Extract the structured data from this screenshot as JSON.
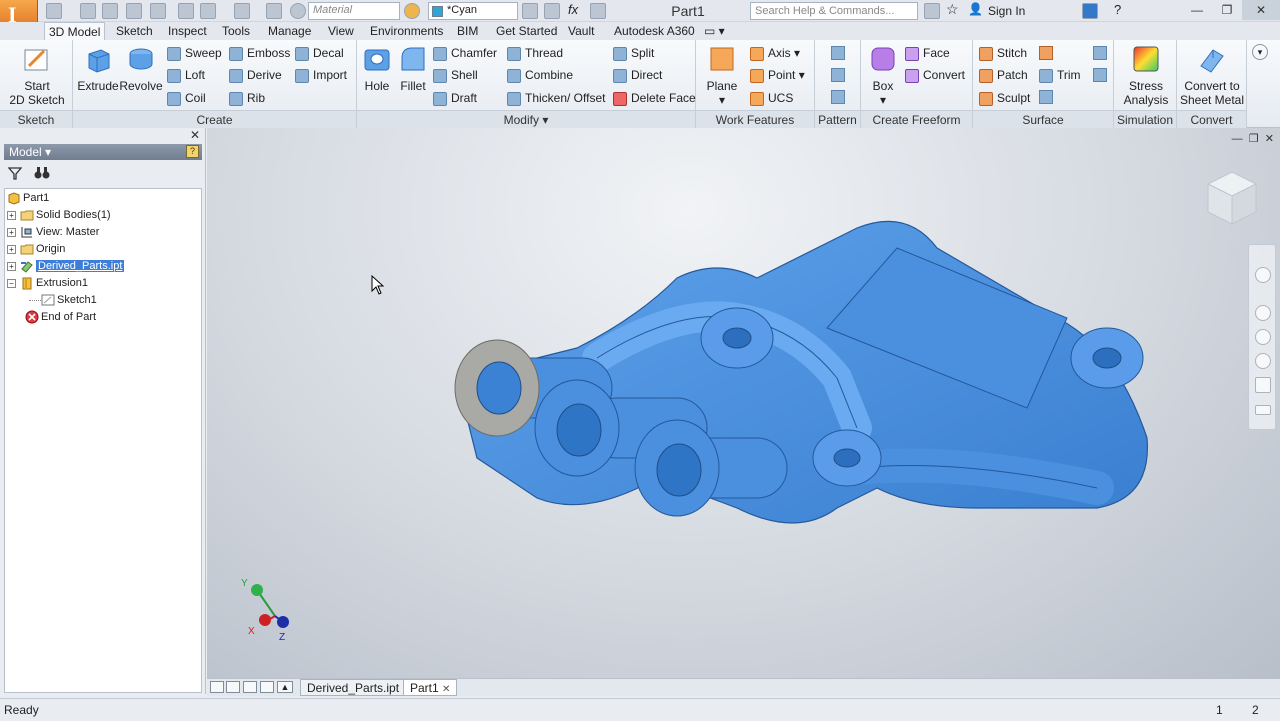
{
  "titlebar": {
    "material_placeholder": "Material",
    "appearance_value": "*Cyan",
    "document_title": "Part1",
    "help_search_placeholder": "Search Help & Commands...",
    "sign_in": "Sign In"
  },
  "menu": {
    "tabs": [
      "3D Model",
      "Sketch",
      "Inspect",
      "Tools",
      "Manage",
      "View",
      "Environments",
      "BIM",
      "Get Started",
      "Vault",
      "Autodesk A360"
    ],
    "active": "3D Model"
  },
  "ribbon": {
    "sketch": {
      "label": "Sketch",
      "start": "Start",
      "start2": "2D Sketch"
    },
    "create": {
      "label": "Create",
      "extrude": "Extrude",
      "revolve": "Revolve",
      "sweep": "Sweep",
      "loft": "Loft",
      "coil": "Coil",
      "emboss": "Emboss",
      "derive": "Derive",
      "rib": "Rib",
      "decal": "Decal",
      "import": "Import"
    },
    "modify": {
      "label": "Modify",
      "hole": "Hole",
      "fillet": "Fillet",
      "chamfer": "Chamfer",
      "shell": "Shell",
      "draft": "Draft",
      "thread": "Thread",
      "combine": "Combine",
      "thicken": "Thicken/ Offset",
      "split": "Split",
      "direct": "Direct",
      "delete_face": "Delete Face"
    },
    "work_features": {
      "label": "Work Features",
      "plane": "Plane",
      "axis": "Axis",
      "point": "Point",
      "ucs": "UCS"
    },
    "pattern": {
      "label": "Pattern"
    },
    "freeform": {
      "label": "Create Freeform",
      "box": "Box",
      "face": "Face",
      "convert": "Convert"
    },
    "surface": {
      "label": "Surface",
      "stitch": "Stitch",
      "patch": "Patch",
      "sculpt": "Sculpt",
      "trim": "Trim"
    },
    "simulation": {
      "label": "Simulation",
      "stress1": "Stress",
      "stress2": "Analysis"
    },
    "convert": {
      "label": "Convert",
      "c1": "Convert to",
      "c2": "Sheet Metal"
    }
  },
  "browser": {
    "title": "Model",
    "tree": [
      {
        "label": "Part1",
        "level": 0,
        "icon": "part-icon"
      },
      {
        "label": "Solid Bodies(1)",
        "level": 1,
        "icon": "folder-icon"
      },
      {
        "label": "View: Master",
        "level": 1,
        "icon": "view-icon"
      },
      {
        "label": "Origin",
        "level": 1,
        "icon": "folder-icon"
      },
      {
        "label": "Derived_Parts.ipt",
        "level": 1,
        "icon": "derived-icon",
        "selected": true
      },
      {
        "label": "Extrusion1",
        "level": 1,
        "icon": "extrusion-icon"
      },
      {
        "label": "Sketch1",
        "level": 2,
        "icon": "sketch-icon"
      },
      {
        "label": "End of Part",
        "level": 1,
        "icon": "end-of-part-icon"
      }
    ]
  },
  "colors": {
    "part": "#4a90df",
    "part_dark": "#2c6fbf",
    "accent": "#3d7fd8"
  },
  "doc_tabs": [
    "Derived_Parts.ipt",
    "Part1"
  ],
  "status": {
    "text": "Ready",
    "num1": "1",
    "num2": "2"
  }
}
